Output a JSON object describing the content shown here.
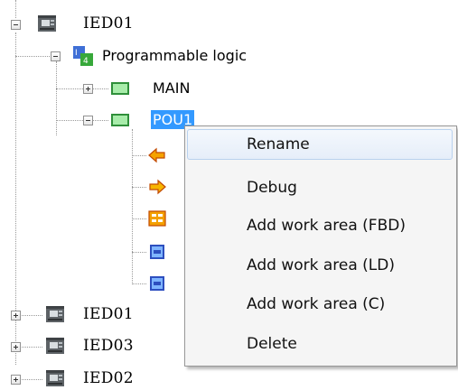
{
  "tree": {
    "root": {
      "label": "IED01",
      "icon": "device-icon",
      "expanded": true
    },
    "logic": {
      "label": "Programmable logic",
      "icon": "programmable-logic-icon",
      "expanded": true
    },
    "main": {
      "label": "MAIN",
      "icon": "program-block-icon",
      "expanded": false
    },
    "pou": {
      "label": "POU1",
      "icon": "program-block-icon",
      "expanded": true,
      "selected": true
    },
    "pou_children": [
      {
        "icon": "input-arrow-icon"
      },
      {
        "icon": "output-arrow-icon"
      },
      {
        "icon": "variables-icon"
      },
      {
        "icon": "work-area-icon"
      },
      {
        "icon": "work-area-icon"
      }
    ],
    "devices": [
      {
        "label": "IED01",
        "icon": "device-icon",
        "expanded": false
      },
      {
        "label": "IED03",
        "icon": "device-icon",
        "expanded": false
      },
      {
        "label": "IED02",
        "icon": "device-icon",
        "expanded": false
      }
    ]
  },
  "context_menu": {
    "items": [
      {
        "label": "Rename",
        "hovered": true
      },
      {
        "label": "Debug"
      },
      {
        "label": "Add work area (FBD)"
      },
      {
        "label": "Add work area (LD)"
      },
      {
        "label": "Add work area (C)"
      },
      {
        "label": "Delete"
      }
    ]
  },
  "colors": {
    "selection": "#3399ff",
    "menu_background": "#f5f5f5",
    "menu_hover": "#e6eef9",
    "block_green": "#8fe08f",
    "arrow_orange": "#f5a300"
  }
}
